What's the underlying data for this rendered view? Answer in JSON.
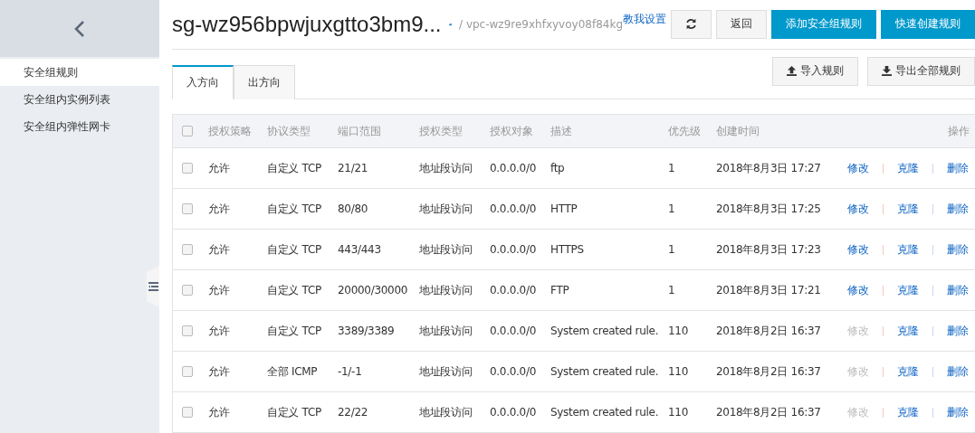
{
  "sidebar": {
    "items": [
      {
        "label": "安全组规则",
        "selected": true
      },
      {
        "label": "安全组内实例列表",
        "selected": false
      },
      {
        "label": "安全组内弹性网卡",
        "selected": false
      }
    ]
  },
  "header": {
    "title": "sg-wz956bpwjuxgtto3bm9...",
    "vpc": "/ vpc-wz9re9xhfxyvoy08f84kg",
    "help_link": "教我设置",
    "buttons": [
      {
        "kind": "refresh"
      },
      {
        "kind": "default",
        "label": "返回"
      },
      {
        "kind": "primary",
        "label": "添加安全组规则"
      },
      {
        "kind": "primary",
        "label": "快速创建规则"
      }
    ]
  },
  "tabs": [
    {
      "label": "入方向",
      "selected": true
    },
    {
      "label": "出方向",
      "selected": false
    }
  ],
  "tab_actions": [
    {
      "kind": "upload",
      "label": "导入规则"
    },
    {
      "kind": "download",
      "label": "导出全部规则"
    }
  ],
  "table": {
    "select_all_checked": false,
    "columns": [
      "授权策略",
      "协议类型",
      "端口范围",
      "授权类型",
      "授权对象",
      "描述",
      "优先级",
      "创建时间",
      "操作"
    ],
    "rows": [
      {
        "checked": false,
        "cells": [
          "允许",
          "自定义 TCP",
          "21/21",
          "地址段访问",
          "0.0.0.0/0",
          "ftp",
          "1",
          "2018年8月3日 17:27"
        ],
        "actions": [
          {
            "label": "修改",
            "disabled": false
          },
          {
            "label": "克隆",
            "disabled": false
          },
          {
            "label": "删除",
            "disabled": false
          }
        ]
      },
      {
        "checked": false,
        "cells": [
          "允许",
          "自定义 TCP",
          "80/80",
          "地址段访问",
          "0.0.0.0/0",
          "HTTP",
          "1",
          "2018年8月3日 17:25"
        ],
        "actions": [
          {
            "label": "修改",
            "disabled": false
          },
          {
            "label": "克隆",
            "disabled": false
          },
          {
            "label": "删除",
            "disabled": false
          }
        ]
      },
      {
        "checked": false,
        "cells": [
          "允许",
          "自定义 TCP",
          "443/443",
          "地址段访问",
          "0.0.0.0/0",
          "HTTPS",
          "1",
          "2018年8月3日 17:23"
        ],
        "actions": [
          {
            "label": "修改",
            "disabled": false
          },
          {
            "label": "克隆",
            "disabled": false
          },
          {
            "label": "删除",
            "disabled": false
          }
        ]
      },
      {
        "checked": false,
        "cells": [
          "允许",
          "自定义 TCP",
          "20000/30000",
          "地址段访问",
          "0.0.0.0/0",
          "FTP",
          "1",
          "2018年8月3日 17:21"
        ],
        "actions": [
          {
            "label": "修改",
            "disabled": false
          },
          {
            "label": "克隆",
            "disabled": false
          },
          {
            "label": "删除",
            "disabled": false
          }
        ]
      },
      {
        "checked": false,
        "cells": [
          "允许",
          "自定义 TCP",
          "3389/3389",
          "地址段访问",
          "0.0.0.0/0",
          "System created rule.",
          "110",
          "2018年8月2日 16:37"
        ],
        "actions": [
          {
            "label": "修改",
            "disabled": true
          },
          {
            "label": "克隆",
            "disabled": false
          },
          {
            "label": "删除",
            "disabled": false
          }
        ]
      },
      {
        "checked": false,
        "cells": [
          "允许",
          "全部 ICMP",
          "-1/-1",
          "地址段访问",
          "0.0.0.0/0",
          "System created rule.",
          "110",
          "2018年8月2日 16:37"
        ],
        "actions": [
          {
            "label": "修改",
            "disabled": true
          },
          {
            "label": "克隆",
            "disabled": false
          },
          {
            "label": "删除",
            "disabled": false
          }
        ]
      },
      {
        "checked": false,
        "cells": [
          "允许",
          "自定义 TCP",
          "22/22",
          "地址段访问",
          "0.0.0.0/0",
          "System created rule.",
          "110",
          "2018年8月2日 16:37"
        ],
        "actions": [
          {
            "label": "修改",
            "disabled": true
          },
          {
            "label": "克隆",
            "disabled": false
          },
          {
            "label": "删除",
            "disabled": false
          }
        ]
      }
    ]
  }
}
